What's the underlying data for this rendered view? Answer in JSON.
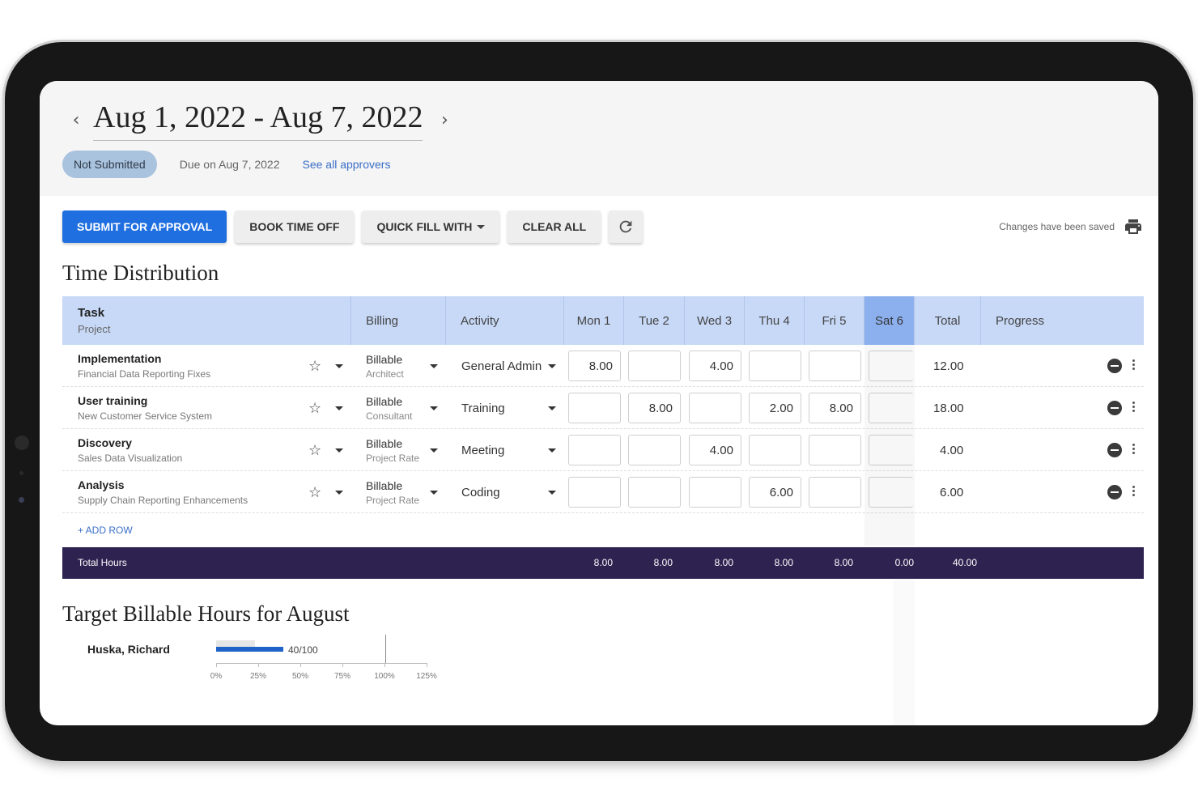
{
  "header": {
    "date_range": "Aug 1, 2022 - Aug 7, 2022",
    "prev_arrow": "‹",
    "next_arrow": "›",
    "status": "Not Submitted",
    "due": "Due on Aug 7, 2022",
    "approvers_link": "See all approvers"
  },
  "toolbar": {
    "submit_label": "SUBMIT FOR APPROVAL",
    "book_time_off_label": "BOOK TIME OFF",
    "quick_fill_label": "QUICK FILL WITH",
    "clear_all_label": "CLEAR ALL",
    "refresh_icon": "refresh-icon",
    "saved_text": "Changes have been saved",
    "print_icon": "print-icon"
  },
  "time_distribution": {
    "title": "Time Distribution",
    "columns": {
      "task": "Task",
      "project": "Project",
      "billing": "Billing",
      "activity": "Activity",
      "days": [
        "Mon 1",
        "Tue 2",
        "Wed 3",
        "Thu 4",
        "Fri 5",
        "Sat 6"
      ],
      "total": "Total",
      "progress": "Progress"
    },
    "rows": [
      {
        "task": "Implementation",
        "project": "Financial Data Reporting Fixes",
        "billing": "Billable",
        "billing_sub": "Architect",
        "activity": "General Admin",
        "hours": [
          "8.00",
          "",
          "4.00",
          "",
          "",
          ""
        ],
        "total": "12.00"
      },
      {
        "task": "User training",
        "project": "New Customer Service System",
        "billing": "Billable",
        "billing_sub": "Consultant",
        "activity": "Training",
        "hours": [
          "",
          "8.00",
          "",
          "2.00",
          "8.00",
          ""
        ],
        "total": "18.00"
      },
      {
        "task": "Discovery",
        "project": "Sales Data Visualization",
        "billing": "Billable",
        "billing_sub": "Project Rate",
        "activity": "Meeting",
        "hours": [
          "",
          "",
          "4.00",
          "",
          "",
          ""
        ],
        "total": "4.00"
      },
      {
        "task": "Analysis",
        "project": "Supply Chain Reporting Enhancements",
        "billing": "Billable",
        "billing_sub": "Project Rate",
        "activity": "Coding",
        "hours": [
          "",
          "",
          "",
          "6.00",
          "",
          ""
        ],
        "total": "6.00"
      }
    ],
    "add_row_label": "+ ADD ROW",
    "totals": {
      "label": "Total Hours",
      "days": [
        "8.00",
        "8.00",
        "8.00",
        "8.00",
        "8.00",
        "0.00"
      ],
      "total": "40.00"
    }
  },
  "target": {
    "title": "Target Billable Hours for August",
    "person": "Huska, Richard",
    "value_label": "40/100",
    "progress_fraction": 0.4,
    "ticks": [
      "0%",
      "25%",
      "50%",
      "75%",
      "100%",
      "125%"
    ]
  },
  "colors": {
    "primary": "#1f6fe0",
    "header_bg": "#c7d9f7",
    "totals_bg": "#2e2250",
    "status_pill": "#a9c2dd"
  }
}
